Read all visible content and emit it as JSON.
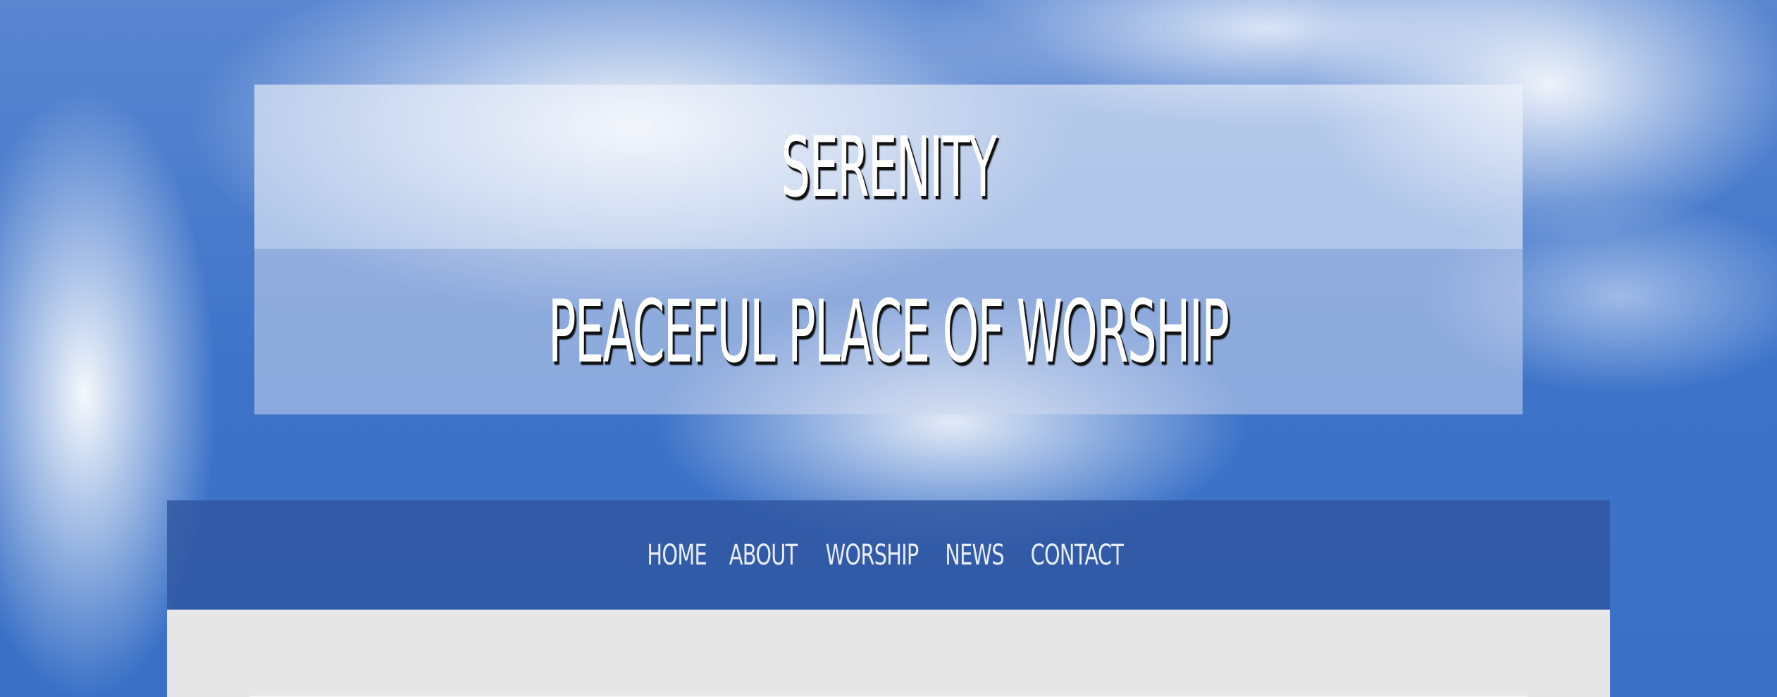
{
  "site": {
    "title": "SERENITY",
    "tagline": "PEACEFUL PLACE OF WORSHIP"
  },
  "nav": {
    "items": [
      {
        "label": "HOME"
      },
      {
        "label": "ABOUT"
      },
      {
        "label": "WORSHIP"
      },
      {
        "label": "NEWS"
      },
      {
        "label": "CONTACT"
      }
    ]
  },
  "colors": {
    "sky": "#3a72c8",
    "nav_bar": "#2f55a0",
    "content_bg": "#e6e6e6",
    "headline_text": "#ffffff",
    "nav_text": "#e8edf8"
  }
}
